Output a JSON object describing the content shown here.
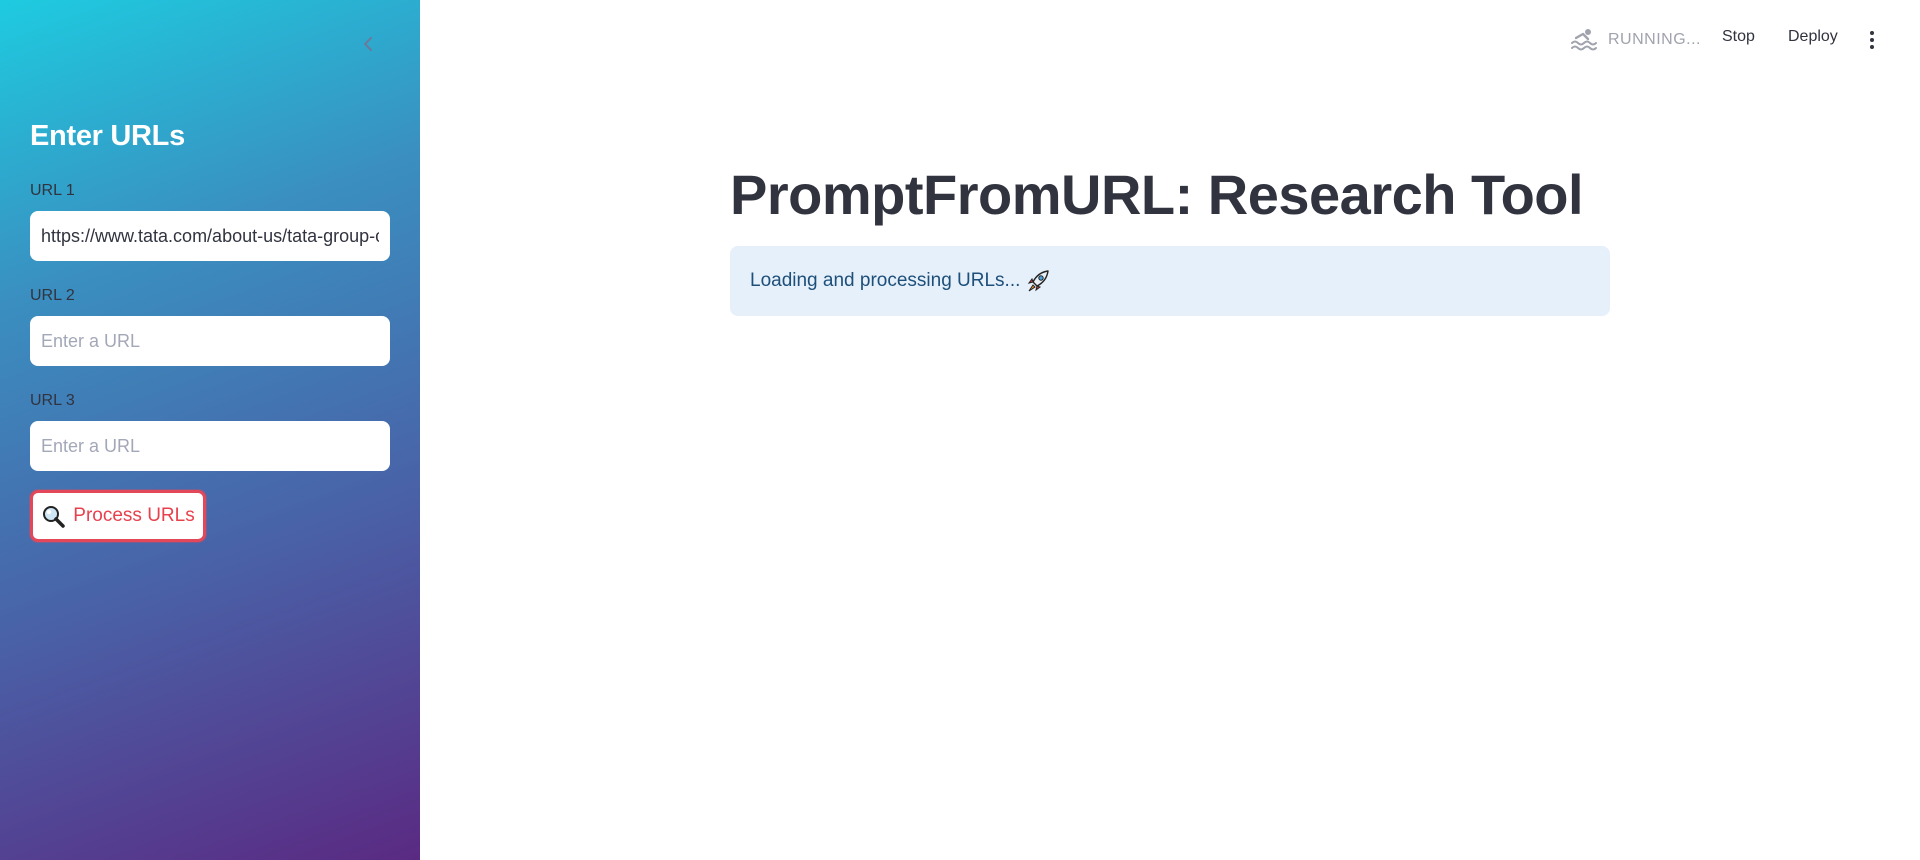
{
  "sidebar": {
    "title": "Enter URLs",
    "fields": [
      {
        "label": "URL 1",
        "value": "https://www.tata.com/about-us/tata-group-our-heritage",
        "placeholder": "Enter a URL"
      },
      {
        "label": "URL 2",
        "value": "",
        "placeholder": "Enter a URL"
      },
      {
        "label": "URL 3",
        "value": "",
        "placeholder": "Enter a URL"
      }
    ],
    "process_button": {
      "icon": "magnifier-icon",
      "label": "Process URLs"
    }
  },
  "header": {
    "status": "RUNNING...",
    "stop_label": "Stop",
    "deploy_label": "Deploy"
  },
  "main": {
    "title": "PromptFromURL: Research Tool",
    "info_text": "Loading and processing URLs...",
    "info_icon": "rocket-icon"
  },
  "colors": {
    "accent": "#e8414d",
    "info_bg": "#e6f0fa",
    "info_text": "#1d4f7a"
  }
}
